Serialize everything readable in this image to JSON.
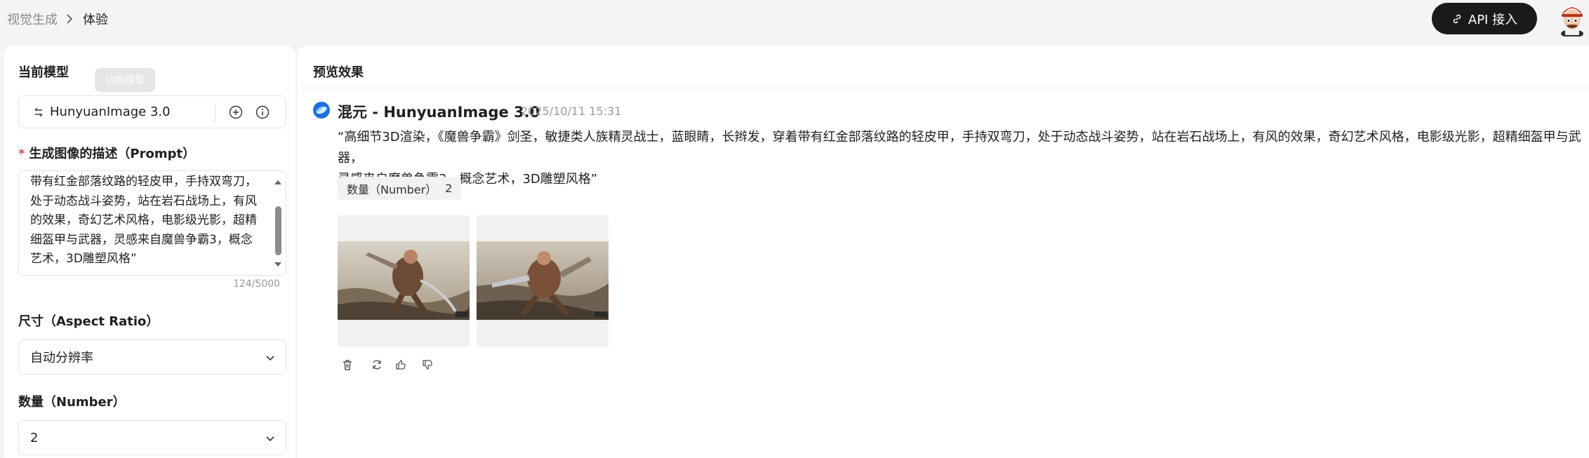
{
  "breadcrumb": {
    "parent": "视觉生成",
    "current": "体验"
  },
  "header": {
    "api_label": "API 接入"
  },
  "left": {
    "model_label": "当前模型",
    "tooltip": "切换模型",
    "model_name": "HunyuanImage 3.0",
    "prompt_label": "生成图像的描述（Prompt）",
    "prompt_lines": [
      "带有红金部落纹路的轻皮甲，手持双弯刀，",
      "处于动态战斗姿势，站在岩石战场上，有风",
      "的效果，奇幻艺术风格，电影级光影，超精",
      "细盔甲与武器，灵感来自魔兽争霸3，概念",
      "艺术，3D雕塑风格”"
    ],
    "prompt_counter": "124/5000",
    "aspect_label": "尺寸（Aspect Ratio）",
    "aspect_value": "自动分辨率",
    "number_label": "数量（Number）",
    "number_value": "2"
  },
  "right": {
    "title": "预览效果",
    "model_header": "混元 - HunyuanImage 3.0",
    "timestamp": "2025/10/11 15:31",
    "desc_lines": [
      "“高细节3D渲染，《魔兽争霸》剑圣，敏捷类人族精灵战士，蓝眼睛，长辫发，穿着带有红金部落纹路的轻皮甲，手持双弯刀，处于动态战斗姿势，站在岩石战场上，有风的效果，奇幻艺术风格，电影级光影，超精细盔甲与武器，",
      "灵感来自魔兽争霸3，概念艺术，3D雕塑风格”"
    ],
    "chip_label": "数量（Number）",
    "chip_value": "2"
  },
  "icons": {
    "swap": "swap-icon",
    "add": "plus-circle-icon",
    "info": "info-icon",
    "chevron": "chevron-down-icon",
    "link": "link-icon",
    "delete": "trash-icon",
    "regenerate": "refresh-icon",
    "like": "thumbs-up-icon",
    "dislike": "thumbs-down-icon"
  },
  "colors": {
    "accent": "#1a1a1a",
    "required": "#e5484d"
  }
}
